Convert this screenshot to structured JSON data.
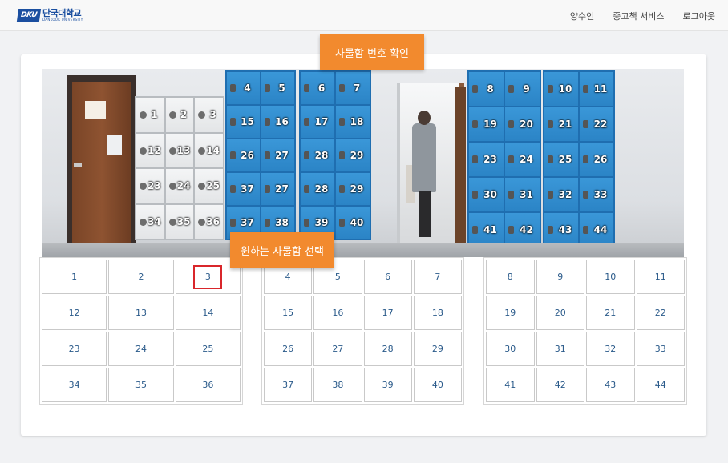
{
  "header": {
    "logo_mark": "DKU",
    "logo_kr": "단국대학교",
    "logo_en": "DANKOOK UNIVERSITY",
    "links": [
      "양수인",
      "중고책 서비스",
      "로그아웃"
    ]
  },
  "tooltips": {
    "top": "사물함 번호 확인",
    "bottom": "원하는 사물함 선택"
  },
  "photo_lockers": {
    "white": [
      "1",
      "2",
      "3",
      "12",
      "13",
      "14",
      "23",
      "24",
      "25",
      "34",
      "35",
      "36"
    ],
    "blue_a": [
      "4",
      "5",
      "15",
      "16",
      "26",
      "27",
      "37",
      "27",
      "37",
      "38"
    ],
    "blue_b": [
      "6",
      "7",
      "17",
      "18",
      "28",
      "29",
      "28",
      "29",
      "39",
      "40"
    ],
    "blue_c": [
      "8",
      "9",
      "19",
      "20",
      "23",
      "24",
      "30",
      "31",
      "41",
      "42"
    ],
    "blue_d": [
      "10",
      "11",
      "21",
      "22",
      "25",
      "26",
      "32",
      "33",
      "43",
      "44"
    ]
  },
  "grid": {
    "left": [
      "1",
      "2",
      "3",
      "12",
      "13",
      "14",
      "23",
      "24",
      "25",
      "34",
      "35",
      "36"
    ],
    "mid": [
      "4",
      "5",
      "6",
      "7",
      "15",
      "16",
      "17",
      "18",
      "26",
      "27",
      "28",
      "29",
      "37",
      "38",
      "39",
      "40"
    ],
    "right": [
      "8",
      "9",
      "10",
      "11",
      "19",
      "20",
      "21",
      "22",
      "30",
      "31",
      "32",
      "33",
      "41",
      "42",
      "43",
      "44"
    ],
    "highlighted": "3"
  },
  "colors": {
    "tooltip": "#f28a2e",
    "highlight_border": "#d9262b",
    "cell_text": "#2a5a8a",
    "locker_blue": "#2b84c6"
  }
}
